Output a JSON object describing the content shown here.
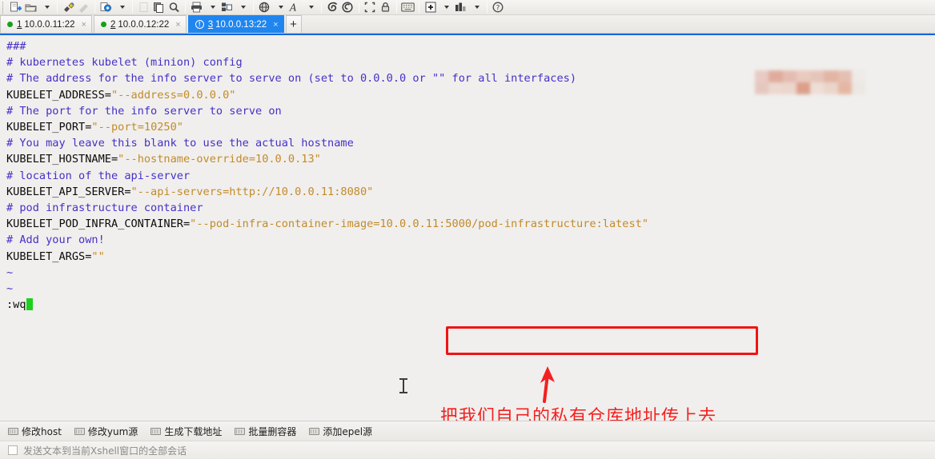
{
  "toolbar": {
    "items": [
      {
        "name": "new-session-icon",
        "label": "New Session"
      },
      {
        "name": "open-folder-icon",
        "label": "Open"
      },
      {
        "name": "open-folder-dropdown-icon",
        "label": "Open menu"
      },
      {
        "name": "connect-icon",
        "label": "Connect"
      },
      {
        "name": "disconnect-icon",
        "label": "Disconnect"
      },
      {
        "name": "properties-gear-icon",
        "label": "Properties"
      },
      {
        "name": "properties-dropdown-icon",
        "label": "Properties menu"
      },
      {
        "name": "paste-icon",
        "label": "Paste"
      },
      {
        "name": "copy-icon",
        "label": "Copy"
      },
      {
        "name": "find-icon",
        "label": "Find"
      },
      {
        "name": "print-icon",
        "label": "Print"
      },
      {
        "name": "print-dropdown-icon",
        "label": "Print menu"
      },
      {
        "name": "layout-icon",
        "label": "Layout"
      },
      {
        "name": "layout-dropdown-icon",
        "label": "Layout menu"
      },
      {
        "name": "globe-icon",
        "label": "Web"
      },
      {
        "name": "globe-dropdown-icon",
        "label": "Web menu"
      },
      {
        "name": "font-icon",
        "label": "Font"
      },
      {
        "name": "font-dropdown-icon",
        "label": "Font menu"
      },
      {
        "name": "xftp-icon",
        "label": "Xftp"
      },
      {
        "name": "xagent-icon",
        "label": "Xagent"
      },
      {
        "name": "fullscreen-icon",
        "label": "Full Screen"
      },
      {
        "name": "lock-icon",
        "label": "Lock"
      },
      {
        "name": "keyboard-icon",
        "label": "Keyboard"
      },
      {
        "name": "zoom-in-icon",
        "label": "Zoom"
      },
      {
        "name": "zoom-dropdown-icon",
        "label": "Zoom menu"
      },
      {
        "name": "panel-icon",
        "label": "Panel"
      },
      {
        "name": "panel-dropdown-icon",
        "label": "Panel menu"
      },
      {
        "name": "help-icon",
        "label": "Help"
      }
    ]
  },
  "tabs": {
    "items": [
      {
        "num": "1",
        "title": "10.0.0.11:22",
        "status": "connected",
        "active": false,
        "close": "×"
      },
      {
        "num": "2",
        "title": "10.0.0.12:22",
        "status": "connected",
        "active": false,
        "close": "×"
      },
      {
        "num": "3",
        "title": "10.0.0.13:22",
        "status": "warning",
        "active": true,
        "close": "×"
      }
    ],
    "add_label": "+",
    "warning_glyph": "!"
  },
  "terminal": {
    "lines": [
      [
        {
          "t": "###",
          "c": "comment"
        }
      ],
      [
        {
          "t": "# kubernetes kubelet (minion) config",
          "c": "comment"
        }
      ],
      [
        {
          "t": "",
          "c": "code"
        }
      ],
      [
        {
          "t": "# The address for the info server to serve on (set to 0.0.0.0 or \"\" for all interfaces)",
          "c": "comment"
        }
      ],
      [
        {
          "t": "KUBELET_ADDRESS=",
          "c": "code"
        },
        {
          "t": "\"--address=0.0.0.0\"",
          "c": "str"
        }
      ],
      [
        {
          "t": "",
          "c": "code"
        }
      ],
      [
        {
          "t": "# The port for the info server to serve on",
          "c": "comment"
        }
      ],
      [
        {
          "t": "KUBELET_PORT=",
          "c": "code"
        },
        {
          "t": "\"--port=10250\"",
          "c": "str"
        }
      ],
      [
        {
          "t": "",
          "c": "code"
        }
      ],
      [
        {
          "t": "# You may leave this blank to use the actual hostname",
          "c": "comment"
        }
      ],
      [
        {
          "t": "KUBELET_HOSTNAME=",
          "c": "code"
        },
        {
          "t": "\"--hostname-override=10.0.0.13\"",
          "c": "str"
        }
      ],
      [
        {
          "t": "",
          "c": "code"
        }
      ],
      [
        {
          "t": "# location of the api-server",
          "c": "comment"
        }
      ],
      [
        {
          "t": "KUBELET_API_SERVER=",
          "c": "code"
        },
        {
          "t": "\"--api-servers=http://10.0.0.11:8080\"",
          "c": "str"
        }
      ],
      [
        {
          "t": "",
          "c": "code"
        }
      ],
      [
        {
          "t": "# pod infrastructure container",
          "c": "comment"
        }
      ],
      [
        {
          "t": "KUBELET_POD_INFRA_CONTAINER=",
          "c": "code"
        },
        {
          "t": "\"--pod-infra-container-image=10.0.0.11:5000/pod-infrastructure:latest\"",
          "c": "str"
        }
      ],
      [
        {
          "t": "",
          "c": "code"
        }
      ],
      [
        {
          "t": "# Add your own!",
          "c": "comment"
        }
      ],
      [
        {
          "t": "KUBELET_ARGS=",
          "c": "code"
        },
        {
          "t": "\"\"",
          "c": "str"
        }
      ],
      [
        {
          "t": "~",
          "c": "tilde"
        }
      ],
      [
        {
          "t": "~",
          "c": "tilde"
        }
      ],
      [
        {
          "t": ":wq",
          "c": "code"
        },
        {
          "t": "",
          "c": "cursor"
        }
      ]
    ]
  },
  "annotation": {
    "note": "把我们自己的私有仓库地址传上去",
    "highlight_target": "10.0.0.11:5000/pod-infrastructure:latest",
    "color": "#f32020"
  },
  "quickbar": {
    "items": [
      {
        "label": "修改host",
        "icon": "keyboard-icon"
      },
      {
        "label": "修改yum源",
        "icon": "keyboard-icon"
      },
      {
        "label": "生成下载地址",
        "icon": "keyboard-icon"
      },
      {
        "label": "批量删容器",
        "icon": "keyboard-icon"
      },
      {
        "label": "添加epel源",
        "icon": "keyboard-icon"
      }
    ]
  },
  "statusbar": {
    "checkbox_label": "发送文本到当前Xshell窗口的全部会话",
    "checked": false
  },
  "mosaic": {
    "colors": [
      "#e6c3bb",
      "#dd9d8c",
      "#e3b2a4",
      "#e8c3b6",
      "#e5bcae",
      "#e0a995",
      "#e3b5a6",
      "#edeae6",
      "#e3bfb6",
      "#ecd3c9",
      "#ebd0c5",
      "#d88e74",
      "#eddbd2",
      "#ead0c4",
      "#e2ab94",
      "#ece6e0"
    ]
  },
  "colors": {
    "accent": "#1f86f0",
    "comment": "#4530c8",
    "string": "#c38a2a",
    "terminal_bg": "#f0efed",
    "annotation_red": "#f32020"
  }
}
